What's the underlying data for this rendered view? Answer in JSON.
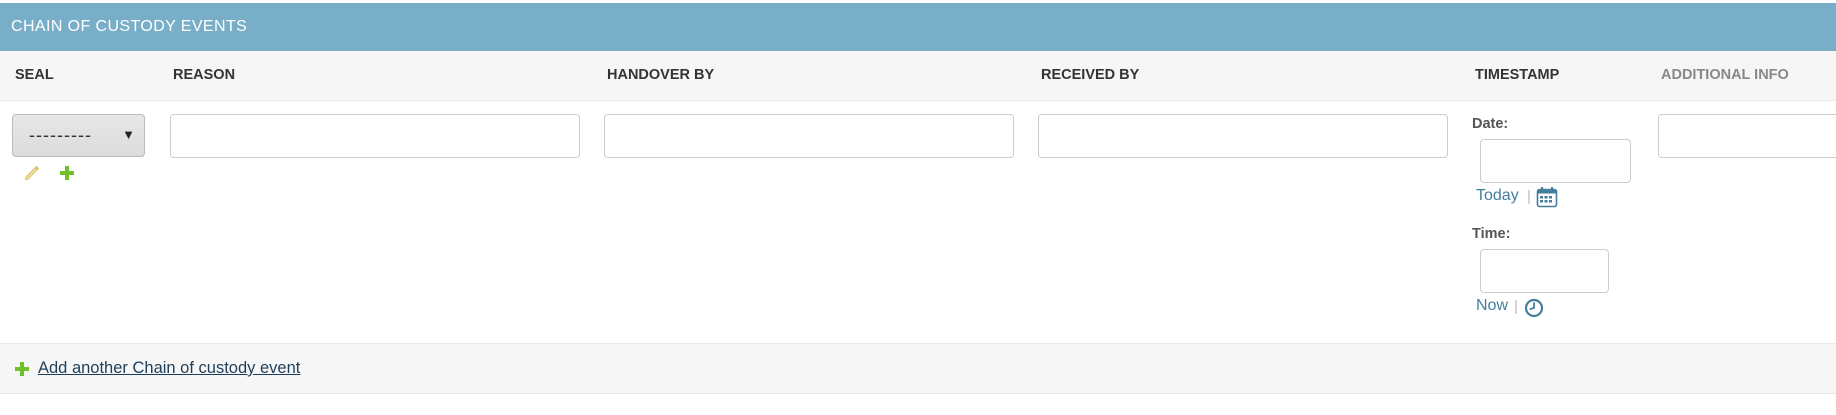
{
  "section": {
    "title": "CHAIN OF CUSTODY EVENTS"
  },
  "columns": {
    "seal": "SEAL",
    "reason": "REASON",
    "handover_by": "HANDOVER BY",
    "received_by": "RECEIVED BY",
    "timestamp": "TIMESTAMP",
    "additional_info": "ADDITIONAL INFO"
  },
  "row": {
    "seal_selected": "---------",
    "reason_value": "",
    "handover_value": "",
    "received_value": "",
    "date_label": "Date:",
    "date_value": "",
    "today_link": "Today",
    "time_label": "Time:",
    "time_value": "",
    "now_link": "Now",
    "separator": "|",
    "additional_value": ""
  },
  "add_another": {
    "label": "Add another Chain of custody event"
  },
  "colors": {
    "caption_bg": "#79aec8",
    "link": "#447e9b",
    "add_icon": "#70bf2b",
    "edit_icon": "#e8d98c"
  },
  "icons": {
    "edit": "pencil-icon",
    "add": "plus-icon",
    "calendar": "calendar-icon",
    "clock": "clock-icon"
  }
}
